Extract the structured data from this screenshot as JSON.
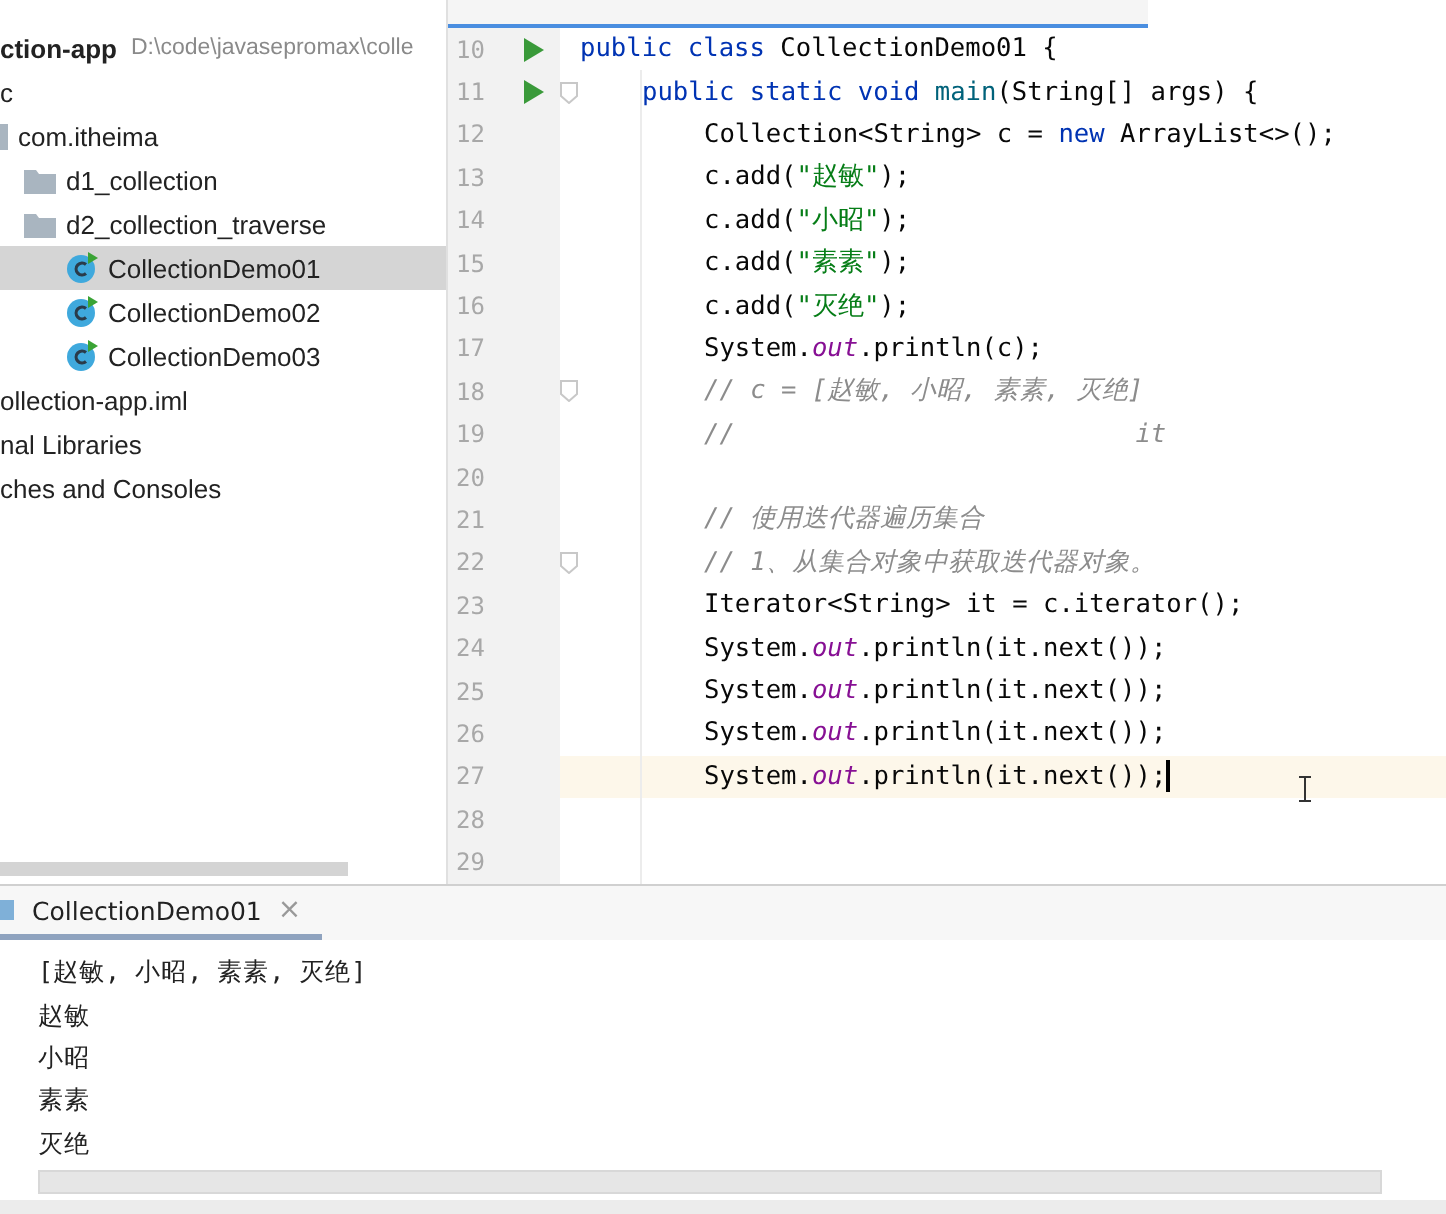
{
  "project_tree": [
    {
      "label": "ction-app",
      "path": "D:\\code\\javasepromax\\colle",
      "kind": "root",
      "selected": false,
      "children": [
        {
          "label": "c",
          "kind": "text",
          "selected": false,
          "children": [
            {
              "label": "com.itheima",
              "kind": "package",
              "selected": false,
              "children": [
                {
                  "label": "d1_collection",
                  "kind": "folder",
                  "selected": false
                },
                {
                  "label": "d2_collection_traverse",
                  "kind": "folder",
                  "selected": false,
                  "children": [
                    {
                      "label": "CollectionDemo01",
                      "kind": "class",
                      "selected": true
                    },
                    {
                      "label": "CollectionDemo02",
                      "kind": "class",
                      "selected": false
                    },
                    {
                      "label": "CollectionDemo03",
                      "kind": "class",
                      "selected": false
                    }
                  ]
                }
              ]
            }
          ]
        },
        {
          "label": "ollection-app.iml",
          "kind": "text",
          "selected": false
        }
      ]
    },
    {
      "label": "nal Libraries",
      "kind": "text",
      "selected": false
    },
    {
      "label": "ches and Consoles",
      "kind": "text",
      "selected": false
    }
  ],
  "editor": {
    "lines": [
      {
        "number": "10",
        "run": true,
        "fold": false,
        "current": false,
        "tokens": [
          {
            "kind": "kw",
            "text": "public class"
          },
          {
            "kind": "plain",
            "text": " CollectionDemo01 {"
          }
        ],
        "children": [
          {
            "number": "11",
            "run": true,
            "fold": true,
            "current": false,
            "tokens": [
              {
                "kind": "kw",
                "text": "public static void"
              },
              {
                "kind": "method",
                "text": " main"
              },
              {
                "kind": "plain",
                "text": "(String[] args) {"
              }
            ],
            "children": [
              {
                "number": "12",
                "run": false,
                "fold": false,
                "current": false,
                "tokens": [
                  {
                    "kind": "plain",
                    "text": "Collection<String> c = "
                  },
                  {
                    "kind": "kw",
                    "text": "new"
                  },
                  {
                    "kind": "plain",
                    "text": " ArrayList<>();"
                  }
                ]
              },
              {
                "number": "13",
                "run": false,
                "fold": false,
                "current": false,
                "tokens": [
                  {
                    "kind": "plain",
                    "text": "c.add("
                  },
                  {
                    "kind": "str",
                    "text": "\"赵敏\""
                  },
                  {
                    "kind": "plain",
                    "text": ");"
                  }
                ]
              },
              {
                "number": "14",
                "run": false,
                "fold": false,
                "current": false,
                "tokens": [
                  {
                    "kind": "plain",
                    "text": "c.add("
                  },
                  {
                    "kind": "str",
                    "text": "\"小昭\""
                  },
                  {
                    "kind": "plain",
                    "text": ");"
                  }
                ]
              },
              {
                "number": "15",
                "run": false,
                "fold": false,
                "current": false,
                "tokens": [
                  {
                    "kind": "plain",
                    "text": "c.add("
                  },
                  {
                    "kind": "str",
                    "text": "\"素素\""
                  },
                  {
                    "kind": "plain",
                    "text": ");"
                  }
                ]
              },
              {
                "number": "16",
                "run": false,
                "fold": false,
                "current": false,
                "tokens": [
                  {
                    "kind": "plain",
                    "text": "c.add("
                  },
                  {
                    "kind": "str",
                    "text": "\"灭绝\""
                  },
                  {
                    "kind": "plain",
                    "text": ");"
                  }
                ]
              },
              {
                "number": "17",
                "run": false,
                "fold": false,
                "current": false,
                "tokens": [
                  {
                    "kind": "plain",
                    "text": "System."
                  },
                  {
                    "kind": "field",
                    "text": "out"
                  },
                  {
                    "kind": "plain",
                    "text": ".println(c);"
                  }
                ]
              },
              {
                "number": "18",
                "run": false,
                "fold": true,
                "current": false,
                "tokens": [
                  {
                    "kind": "comment",
                    "text": "// c = [赵敏, 小昭, 素素, 灭绝]"
                  }
                ]
              },
              {
                "number": "19",
                "run": false,
                "fold": false,
                "current": false,
                "tokens": [
                  {
                    "kind": "comment",
                    "text": "//                          it"
                  }
                ]
              },
              {
                "number": "20",
                "run": false,
                "fold": false,
                "current": false
              },
              {
                "number": "21",
                "run": false,
                "fold": false,
                "current": false,
                "tokens": [
                  {
                    "kind": "comment",
                    "text": "// 使用迭代器遍历集合"
                  }
                ]
              },
              {
                "number": "22",
                "run": false,
                "fold": true,
                "current": false,
                "tokens": [
                  {
                    "kind": "comment",
                    "text": "// 1、从集合对象中获取迭代器对象。"
                  }
                ]
              },
              {
                "number": "23",
                "run": false,
                "fold": false,
                "current": false,
                "tokens": [
                  {
                    "kind": "plain",
                    "text": "Iterator<String> it = c.iterator();"
                  }
                ]
              },
              {
                "number": "24",
                "run": false,
                "fold": false,
                "current": false,
                "tokens": [
                  {
                    "kind": "plain",
                    "text": "System."
                  },
                  {
                    "kind": "field",
                    "text": "out"
                  },
                  {
                    "kind": "plain",
                    "text": ".println(it.next());"
                  }
                ]
              },
              {
                "number": "25",
                "run": false,
                "fold": false,
                "current": false,
                "tokens": [
                  {
                    "kind": "plain",
                    "text": "System."
                  },
                  {
                    "kind": "field",
                    "text": "out"
                  },
                  {
                    "kind": "plain",
                    "text": ".println(it.next());"
                  }
                ]
              },
              {
                "number": "26",
                "run": false,
                "fold": false,
                "current": false,
                "tokens": [
                  {
                    "kind": "plain",
                    "text": "System."
                  },
                  {
                    "kind": "field",
                    "text": "out"
                  },
                  {
                    "kind": "plain",
                    "text": ".println(it.next());"
                  }
                ]
              },
              {
                "number": "27",
                "run": false,
                "fold": false,
                "current": true,
                "tokens": [
                  {
                    "kind": "plain",
                    "text": "System."
                  },
                  {
                    "kind": "field",
                    "text": "out"
                  },
                  {
                    "kind": "plain",
                    "text": ".println(it.next());"
                  }
                ]
              },
              {
                "number": "28",
                "run": false,
                "fold": false,
                "current": false
              },
              {
                "number": "29",
                "run": false,
                "fold": false,
                "current": false
              }
            ]
          }
        ]
      }
    ]
  },
  "run_panel": {
    "tab": {
      "label": "CollectionDemo01",
      "close": "×"
    },
    "output": [
      "[赵敏, 小昭, 素素, 灭绝]",
      "赵敏",
      "小昭",
      "素素",
      "灭绝"
    ]
  }
}
